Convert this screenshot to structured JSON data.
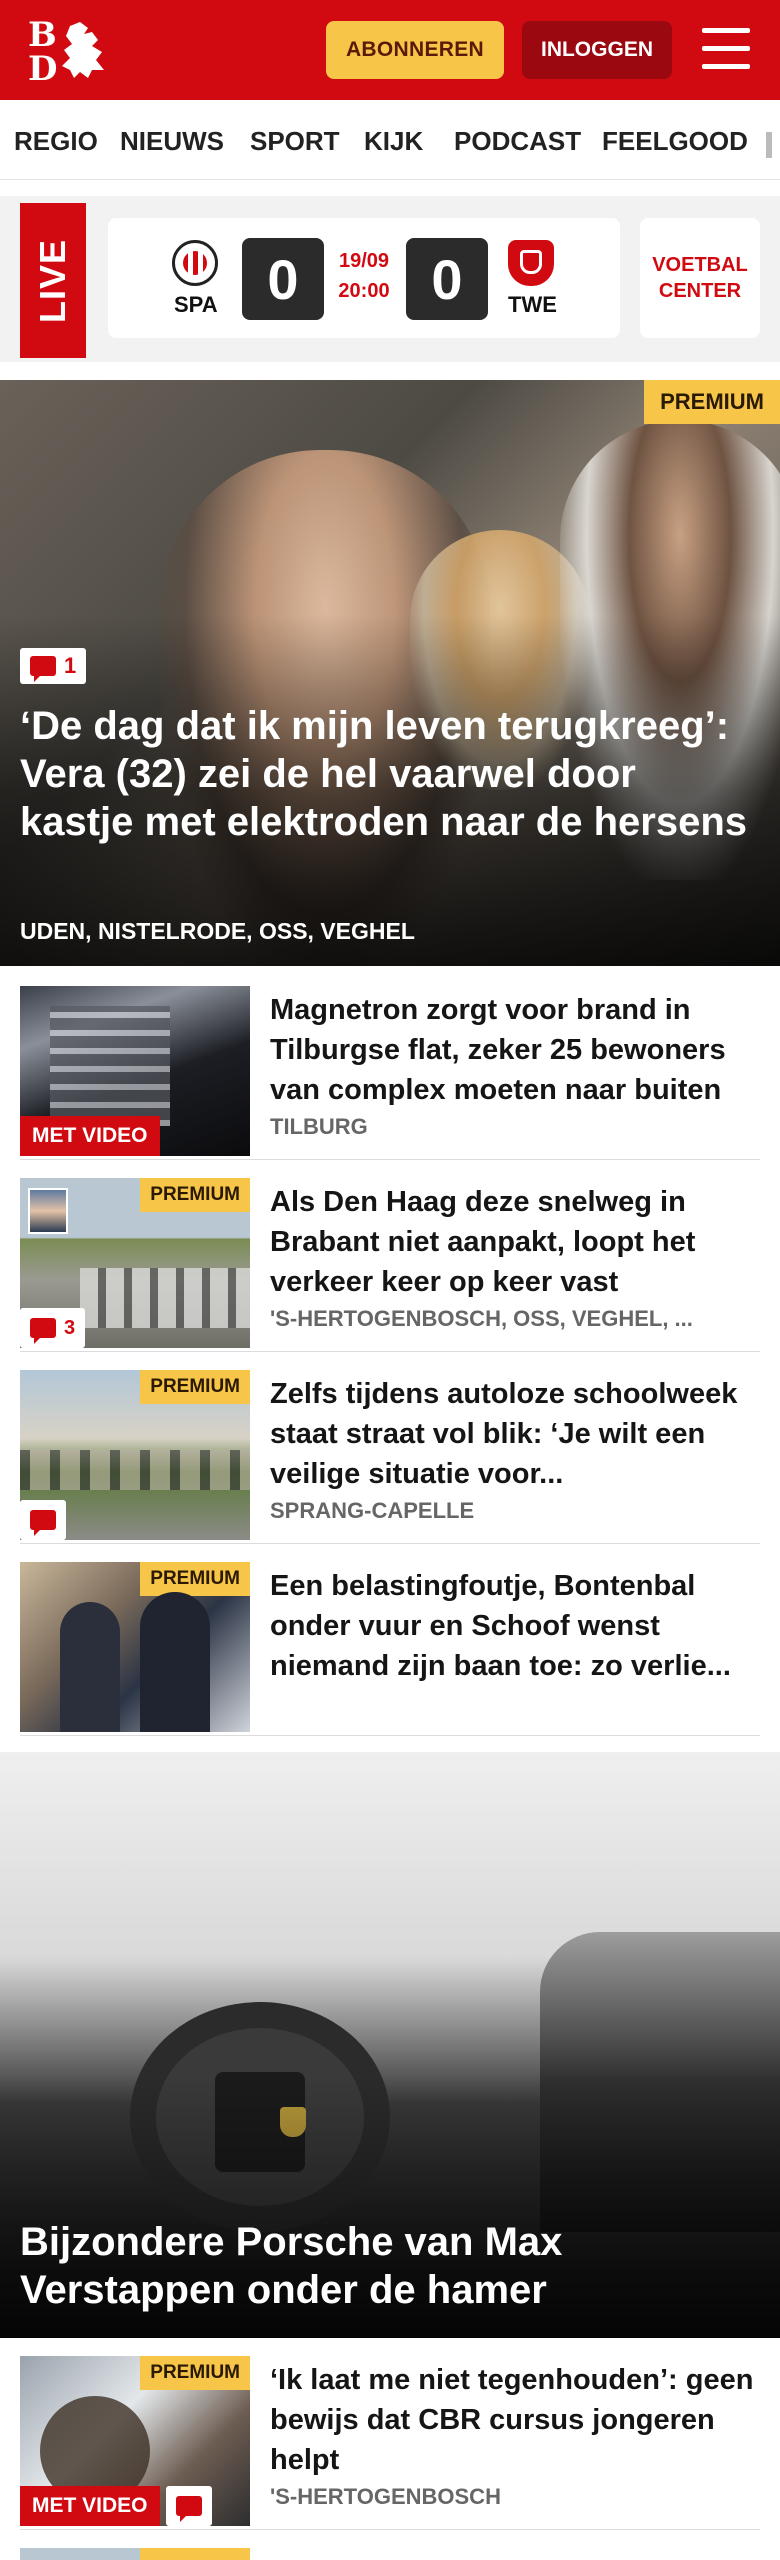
{
  "header": {
    "logo_letters": [
      "B",
      "D"
    ],
    "subscribe_label": "ABONNEREN",
    "login_label": "INLOGGEN",
    "brand_color": "#d10a11"
  },
  "nav": {
    "items": [
      "REGIO",
      "NIEUWS",
      "SPORT",
      "KIJK",
      "PODCAST",
      "FEELGOOD"
    ]
  },
  "live": {
    "label": "LIVE",
    "home_team": "SPA",
    "home_score": "0",
    "away_team": "TWE",
    "away_score": "0",
    "date": "19/09",
    "time": "20:00",
    "center_label_1": "VOETBAL",
    "center_label_2": "CENTER"
  },
  "hero": {
    "badge": "PREMIUM",
    "comments": "1",
    "title": "‘De dag dat ik mijn leven terugkreeg’: Vera (32) zei de hel vaarwel door kastje met elektroden naar de hersens",
    "location": "UDEN, NISTELRODE, OSS, VEGHEL"
  },
  "articles": [
    {
      "title": "Magnetron zorgt voor brand in Tilburgse flat, zeker 25 bewoners van complex moeten naar buiten",
      "location": "TILBURG",
      "video_label": "MET VIDEO"
    },
    {
      "title": "Als Den Haag deze snelweg in Brabant niet aanpakt, loopt het verkeer keer op keer vast",
      "location": "'S-HERTOGENBOSCH, OSS, VEGHEL, ...",
      "badge": "PREMIUM",
      "comments": "3"
    },
    {
      "title": "Zelfs tijdens autoloze schoolweek staat straat vol blik: ‘Je wilt een veilige situatie voor...",
      "location": "SPRANG-CAPELLE",
      "badge": "PREMIUM"
    },
    {
      "title": "Een belastingfoutje, Bontenbal onder vuur en Schoof wenst niemand zijn baan toe: zo verlie...",
      "location": "",
      "badge": "PREMIUM"
    }
  ],
  "feature": {
    "title": "Bijzondere Porsche van Max Verstappen onder de hamer"
  },
  "article_last": {
    "title": "‘Ik laat me niet tegenhouden’: geen bewijs dat CBR cursus jongeren helpt",
    "location": "'S-HERTOGENBOSCH",
    "badge": "PREMIUM",
    "video_label": "MET VIDEO"
  }
}
